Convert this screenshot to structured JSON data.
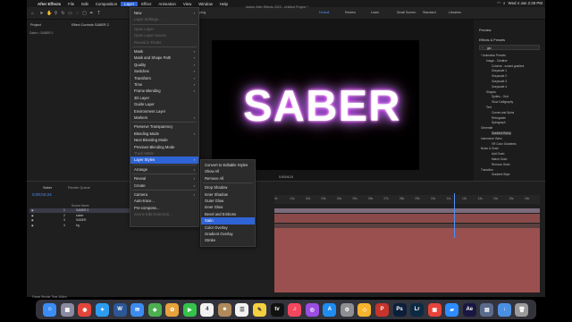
{
  "menubar": {
    "apple": "",
    "items": [
      "After Effects",
      "File",
      "Edit",
      "Composition",
      "Layer",
      "Effect",
      "Animation",
      "View",
      "Window",
      "Help"
    ],
    "active_index": 4,
    "right_text": "Wed 4 Jan  2:28 PM"
  },
  "app_title": "Adobe After Effects 2023 - Untitled Project *",
  "toolbar": {
    "snapping": "Snapping",
    "workspaces": [
      "Default",
      "Review",
      "Learn",
      "Small Screen",
      "Standard",
      "Libraries"
    ],
    "active_workspace": "Default"
  },
  "panels": {
    "project_tab": "Project",
    "effect_controls_tab": "Effect Controls SABER 2",
    "project_item": "Saber • SABER 2",
    "preview_title": "Preview",
    "effects_presets_title": "Effects & Presets",
    "search_value": "glo"
  },
  "viewer": {
    "text": "SABER"
  },
  "effects_tree": [
    "* Animation Presets",
    "Image - Creative",
    "Colorize - sunset gradient",
    "Grayscale 1",
    "Grayscale 2",
    "Grayscale 3",
    "Grayscale 4",
    "Shapes",
    "Synths - Grid",
    "Glow Calligraphy",
    "Text",
    "Curves and Spins",
    "Retrograde",
    "Spirograph",
    "Generate",
    "Gradient Ramp",
    "Immersive Video",
    "VR Color Gradients",
    "Noise & Grain",
    "Add Grain",
    "Match Grain",
    "Remove Grain",
    "Transition",
    "Gradient Wipe"
  ],
  "timeline": {
    "comp_tab": "Saber",
    "render_queue_tab": "Render Queue",
    "timecode": "0;00;04;24",
    "col_header": "Source Name",
    "layers": [
      {
        "num": "1",
        "name": "SABER 2",
        "selected": true
      },
      {
        "num": "2",
        "name": "saber",
        "selected": false
      },
      {
        "num": "3",
        "name": "SABER",
        "selected": false
      },
      {
        "num": "4",
        "name": "bg",
        "selected": false
      }
    ],
    "ruler_labels": [
      "0s",
      "01s",
      "02s",
      "03s",
      "04s",
      "05s",
      "06s",
      "07s",
      "08s",
      "09s",
      "10s",
      "11s",
      "12s",
      "13s",
      "14s",
      "15s",
      "16s"
    ],
    "render_time": "Frame Render Time  160ms",
    "viewer_timecode": "0;00;04;24"
  },
  "layer_menu": [
    {
      "label": "New",
      "arrow": true,
      "disabled": false
    },
    {
      "label": "Layer Settings...",
      "arrow": false,
      "disabled": true
    },
    {
      "sep": true
    },
    {
      "label": "Open Layer",
      "arrow": false,
      "disabled": true
    },
    {
      "label": "Open Layer Source",
      "arrow": false,
      "disabled": true
    },
    {
      "label": "Reveal in Finder",
      "arrow": false,
      "disabled": true
    },
    {
      "sep": true
    },
    {
      "label": "Mask",
      "arrow": true,
      "disabled": false
    },
    {
      "label": "Mask and Shape Path",
      "arrow": true,
      "disabled": false
    },
    {
      "label": "Quality",
      "arrow": true,
      "disabled": false
    },
    {
      "label": "Switches",
      "arrow": true,
      "disabled": false
    },
    {
      "label": "Transform",
      "arrow": true,
      "disabled": false
    },
    {
      "label": "Time",
      "arrow": true,
      "disabled": false
    },
    {
      "label": "Frame Blending",
      "arrow": true,
      "disabled": false
    },
    {
      "label": "3D Layer",
      "arrow": false,
      "disabled": false
    },
    {
      "label": "Guide Layer",
      "arrow": false,
      "disabled": false
    },
    {
      "label": "Environment Layer",
      "arrow": false,
      "disabled": false
    },
    {
      "label": "Markers",
      "arrow": true,
      "disabled": false
    },
    {
      "sep": true
    },
    {
      "label": "Preserve Transparency",
      "arrow": false,
      "disabled": false
    },
    {
      "label": "Blending Mode",
      "arrow": true,
      "disabled": false
    },
    {
      "label": "Next Blending Mode",
      "arrow": false,
      "disabled": false
    },
    {
      "label": "Previous Blending Mode",
      "arrow": false,
      "disabled": false
    },
    {
      "label": "Track Matte",
      "arrow": false,
      "disabled": true
    },
    {
      "label": "Layer Styles",
      "arrow": true,
      "disabled": false,
      "highlight": true
    },
    {
      "sep": true
    },
    {
      "label": "Arrange",
      "arrow": true,
      "disabled": false
    },
    {
      "sep": true
    },
    {
      "label": "Reveal",
      "arrow": true,
      "disabled": false
    },
    {
      "label": "Create",
      "arrow": true,
      "disabled": false
    },
    {
      "sep": true
    },
    {
      "label": "Camera",
      "arrow": true,
      "disabled": false
    },
    {
      "label": "Auto-trace...",
      "arrow": false,
      "disabled": false
    },
    {
      "label": "Pre-compose...",
      "arrow": false,
      "disabled": false
    },
    {
      "label": "Scene Edit Detection...",
      "arrow": false,
      "disabled": true
    }
  ],
  "styles_menu": [
    {
      "label": "Convert to Editable Styles"
    },
    {
      "label": "Show All"
    },
    {
      "label": "Remove All"
    },
    {
      "sep": true
    },
    {
      "label": "Drop Shadow"
    },
    {
      "label": "Inner Shadow"
    },
    {
      "label": "Outer Glow"
    },
    {
      "label": "Inner Glow"
    },
    {
      "label": "Bevel and Emboss"
    },
    {
      "label": "Satin",
      "highlight": true
    },
    {
      "label": "Color Overlay"
    },
    {
      "label": "Gradient Overlay"
    },
    {
      "label": "Stroke"
    }
  ],
  "dock": [
    {
      "name": "finder-icon",
      "glyph": "☺",
      "color": "#3b8df5"
    },
    {
      "name": "launchpad-icon",
      "glyph": "▦",
      "color": "#8a8aa0"
    },
    {
      "name": "chrome-icon",
      "glyph": "◉",
      "color": "#e2463a"
    },
    {
      "name": "safari-icon",
      "glyph": "✦",
      "color": "#2c9cf0"
    },
    {
      "name": "word-icon",
      "glyph": "W",
      "color": "#2b5797"
    },
    {
      "name": "mail-icon",
      "glyph": "✉",
      "color": "#3c8cf0"
    },
    {
      "name": "maps-icon",
      "glyph": "◆",
      "color": "#4caf50"
    },
    {
      "name": "photos-icon",
      "glyph": "✿",
      "color": "#e8a23a"
    },
    {
      "name": "facetime-icon",
      "glyph": "▶",
      "color": "#35c24a"
    },
    {
      "name": "calendar-icon",
      "glyph": "4",
      "color": "#f2f2f2"
    },
    {
      "name": "contacts-icon",
      "glyph": "☻",
      "color": "#b08a5a"
    },
    {
      "name": "reminders-icon",
      "glyph": "☰",
      "color": "#f2f2f2"
    },
    {
      "name": "notes-icon",
      "glyph": "✎",
      "color": "#f4d03f"
    },
    {
      "name": "tv-icon",
      "glyph": "tv",
      "color": "#111111"
    },
    {
      "name": "music-icon",
      "glyph": "♫",
      "color": "#f2475e"
    },
    {
      "name": "podcasts-icon",
      "glyph": "◎",
      "color": "#9b4de3"
    },
    {
      "name": "appstore-icon",
      "glyph": "A",
      "color": "#1f8cf2"
    },
    {
      "name": "settings-icon",
      "glyph": "⚙",
      "color": "#8e8e93"
    },
    {
      "name": "sketch-icon",
      "glyph": "◇",
      "color": "#f7b32b"
    },
    {
      "name": "pdf-icon",
      "glyph": "P",
      "color": "#c7342b"
    },
    {
      "name": "photoshop-icon",
      "glyph": "Ps",
      "color": "#0b1f3a"
    },
    {
      "name": "lightroom-icon",
      "glyph": "Lr",
      "color": "#0c2a44"
    },
    {
      "name": "app-icon",
      "glyph": "▣",
      "color": "#e7433a"
    },
    {
      "name": "zoom-icon",
      "glyph": "▰",
      "color": "#2d8cff"
    },
    {
      "name": "aftereffects-icon",
      "glyph": "Ae",
      "color": "#1a1642"
    },
    {
      "name": "preview-icon",
      "glyph": "▤",
      "color": "#5a6b8c"
    },
    {
      "name": "downloads-icon",
      "glyph": "↓",
      "color": "#4a90e2"
    },
    {
      "name": "trash-icon",
      "glyph": "🗑",
      "color": "#9a9a9a"
    }
  ]
}
